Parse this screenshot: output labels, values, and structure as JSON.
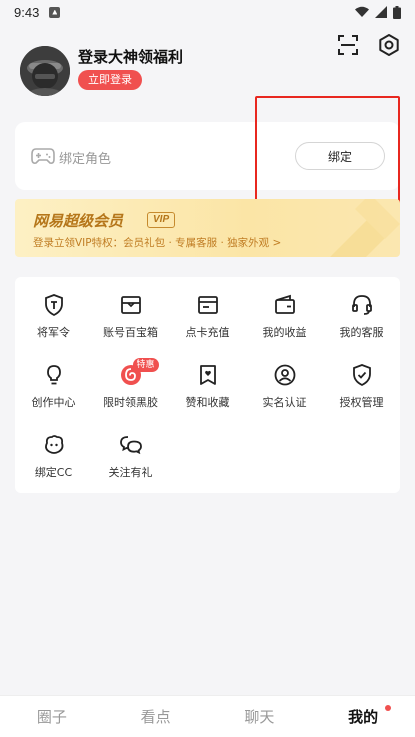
{
  "status_bar": {
    "time": "9:43"
  },
  "profile": {
    "username": "登录大神领福利",
    "login_label": "立即登录"
  },
  "bind_card": {
    "label": "绑定角色",
    "button_label": "绑定"
  },
  "vip": {
    "title": "网易超级会员",
    "badge": "VIP",
    "subtitle": "登录立领VIP特权：会员礼包 · 专属客服 · 独家外观 >"
  },
  "grid": {
    "items": [
      {
        "label": "将军令",
        "icon": "shield-t-icon"
      },
      {
        "label": "账号百宝箱",
        "icon": "treasure-box-icon"
      },
      {
        "label": "点卡充值",
        "icon": "card-icon"
      },
      {
        "label": "我的收益",
        "icon": "wallet-icon"
      },
      {
        "label": "我的客服",
        "icon": "headset-icon"
      },
      {
        "label": "创作中心",
        "icon": "bulb-icon"
      },
      {
        "label": "限时领黑胶",
        "icon": "vinyl-icon",
        "tag": "特惠"
      },
      {
        "label": "赞和收藏",
        "icon": "bookmark-heart-icon"
      },
      {
        "label": "实名认证",
        "icon": "user-verify-icon"
      },
      {
        "label": "授权管理",
        "icon": "shield-check-icon"
      },
      {
        "label": "绑定CC",
        "icon": "cc-icon"
      },
      {
        "label": "关注有礼",
        "icon": "wechat-icon"
      }
    ]
  },
  "bottom_nav": {
    "items": [
      "圈子",
      "看点",
      "聊天",
      "我的"
    ],
    "active_index": 3
  },
  "colors": {
    "accent": "#f0504f",
    "vip_text": "#b5761a",
    "highlight": "#e8271f"
  }
}
